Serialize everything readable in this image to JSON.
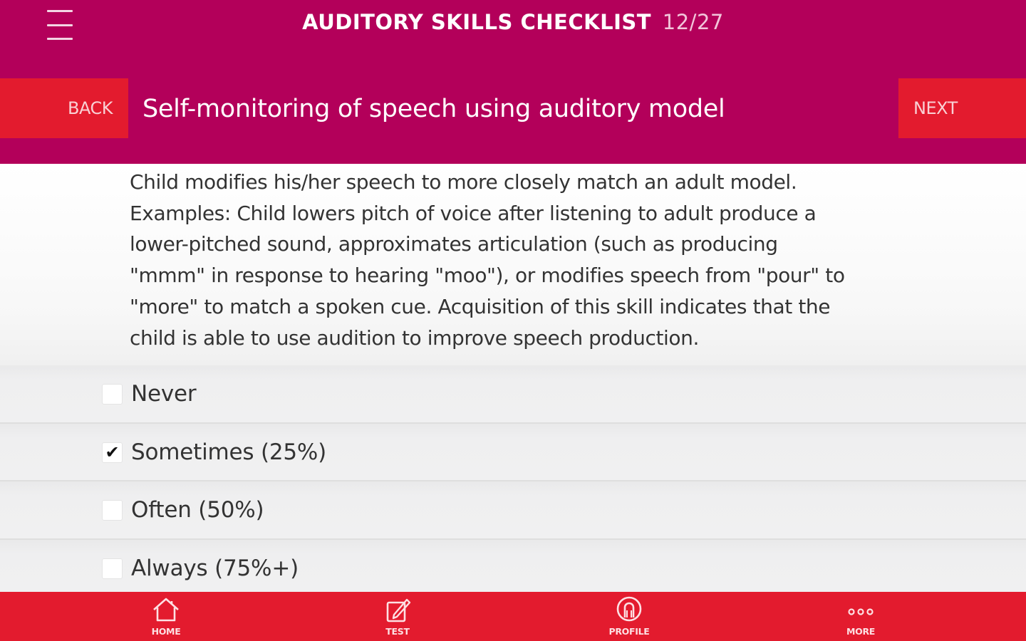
{
  "header": {
    "title": "AUDITORY SKILLS CHECKLIST",
    "progress": "12/27",
    "menu_icon": "hamburger-menu-icon"
  },
  "nav": {
    "back_label": "BACK",
    "next_label": "NEXT"
  },
  "skill": {
    "title": "Self-monitoring of speech using auditory model",
    "description": [
      "Child modifies his/her speech to more closely match an adult model.",
      "Examples: Child lowers pitch of voice after listening to adult produce a",
      "lower-pitched sound, approximates articulation (such as producing",
      "\"mmm\" in response to hearing \"moo\"), or modifies speech from \"pour\" to",
      "\"more\" to match a spoken cue. Acquisition of this skill indicates that the",
      "child is able to use audition to improve speech production."
    ]
  },
  "options": [
    {
      "label": "Never",
      "checked": false
    },
    {
      "label": "Sometimes (25%)",
      "checked": true
    },
    {
      "label": "Often (50%)",
      "checked": false
    },
    {
      "label": "Always (75%+)",
      "checked": false
    }
  ],
  "tabbar": [
    {
      "label": "HOME",
      "icon": "home-icon"
    },
    {
      "label": "TEST",
      "icon": "edit-icon"
    },
    {
      "label": "PROFILE",
      "icon": "profile-icon"
    },
    {
      "label": "MORE",
      "icon": "more-dots-icon"
    }
  ],
  "colors": {
    "header_bg": "#b3005a",
    "accent_red": "#e31b2e"
  }
}
